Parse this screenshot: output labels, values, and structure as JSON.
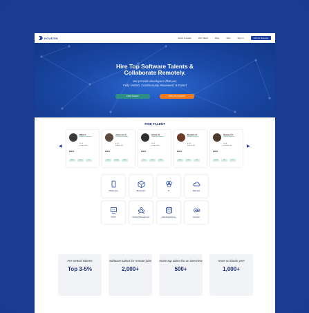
{
  "nav": {
    "logo": "KOVATEK",
    "links": [
      "About Kovatek",
      "Hire Talent",
      "Blog",
      "Jobs",
      "Sign in"
    ],
    "cta": "Submit Request"
  },
  "hero": {
    "title_line1": "Hire Top Software Talents &",
    "title_line2": "Collaborate Remotely.",
    "sub_line1": "We provide developers that are;",
    "sub_line2": "Fully Vetted, Continuously Reviewed, & Rated",
    "find_button": "FIND TALENT",
    "join_button": "JOIN AS A TALENT"
  },
  "find_talent": {
    "title": "FIND TALENT",
    "cards": [
      {
        "name": "Mike F.",
        "role": "Backend Developer",
        "meta1": "5.0",
        "meta2": "Lagos, NG",
        "rate": "$30/hr",
        "tags": [
          "Node",
          "Python",
          "Go"
        ],
        "avatar_color": "#3a3a3a"
      },
      {
        "name": "Johnson O.",
        "role": "Full Stack Developer",
        "meta1": "5.0",
        "meta2": "Abuja, NG",
        "rate": "$40/hr",
        "tags": [
          "React",
          "Django",
          "AWS"
        ],
        "avatar_color": "#5a4a3f"
      },
      {
        "name": "Adam M.",
        "role": "Frontend Developer",
        "meta1": "4.9",
        "meta2": "Lagos, NG",
        "rate": "$25/hr",
        "tags": [
          "Vue",
          "React",
          "CSS"
        ],
        "avatar_color": "#2f2f2f"
      },
      {
        "name": "Daniels O.",
        "role": "Mobile Developer",
        "meta1": "5.0",
        "meta2": "Accra, GH",
        "rate": "$35/hr",
        "tags": [
          "Flutter",
          "Kotlin",
          "iOS"
        ],
        "avatar_color": "#6b3b2a"
      },
      {
        "name": "Samuel O.",
        "role": "DevOps Engineer",
        "meta1": "4.8",
        "meta2": "Nairobi, KE",
        "rate": "$45/hr",
        "tags": [
          "Docker",
          "K8s",
          "GCP"
        ],
        "avatar_color": "#4a3a2e"
      }
    ]
  },
  "categories": [
    {
      "label": "Mobile App",
      "icon": "phone-icon"
    },
    {
      "label": "Blockchain",
      "icon": "cube-icon"
    },
    {
      "label": "AI",
      "icon": "brain-icon"
    },
    {
      "label": "Web App",
      "icon": "cloud-icon"
    },
    {
      "label": "UI/UX",
      "icon": "design-icon"
    },
    {
      "label": "Product Management",
      "icon": "team-icon"
    },
    {
      "label": "Data Engineering",
      "icon": "database-icon"
    },
    {
      "label": "DevOps",
      "icon": "gears-icon"
    }
  ],
  "stats": [
    {
      "question": "Pre-vetted Talents",
      "big": "Top 3-5%",
      "caption": "...",
      "note": "..."
    },
    {
      "question": "Software talent for remote jobs",
      "big": "2,000+",
      "caption": "...",
      "note": "..."
    },
    {
      "question": "Invite top talent for an interview",
      "big": "500+",
      "caption": "...",
      "note": "..."
    },
    {
      "question": "Have no funds yet?",
      "big": "1,000+",
      "caption": "...",
      "note": "..."
    }
  ],
  "colors": {
    "primary": "#1d3fa0",
    "teal": "#2e8d86",
    "orange": "#f07b23",
    "frame": "#1b3b93"
  }
}
